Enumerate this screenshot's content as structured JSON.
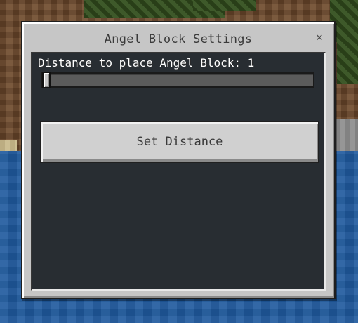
{
  "dialog": {
    "title": "Angel Block Settings",
    "close_icon": "close-icon",
    "distance_label": "Distance to place Angel Block: 1",
    "slider": {
      "value": 1,
      "min": 1,
      "max": 10
    },
    "button_label": "Set Distance"
  },
  "colors": {
    "dialog_bg": "#c6c6c6",
    "panel_bg": "#0e141a",
    "label_text": "#ffffff",
    "water": "#1f5a9e",
    "dirt": "#6e4a2c",
    "foliage": "#34501f"
  }
}
